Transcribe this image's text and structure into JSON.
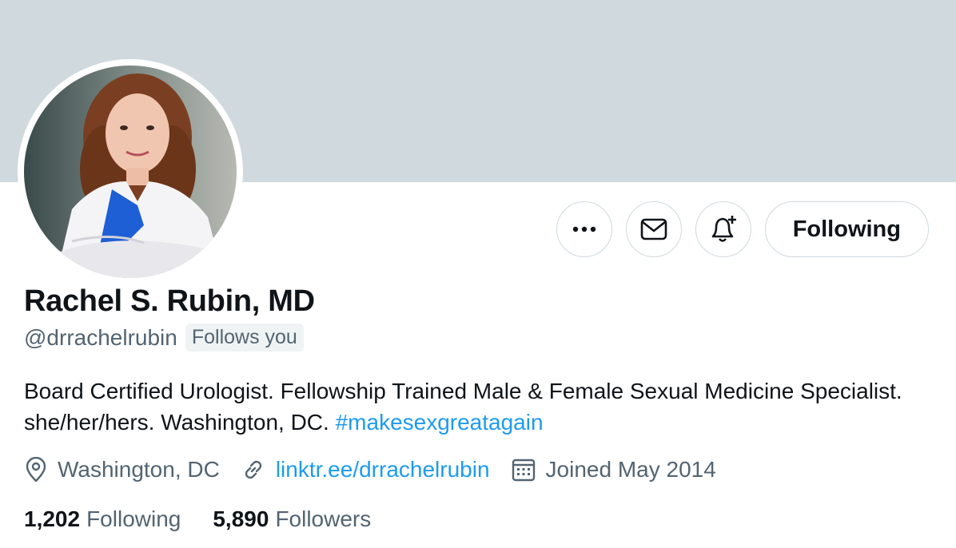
{
  "profile": {
    "display_name": "Rachel S. Rubin, MD",
    "handle": "@drrachelrubin",
    "follows_you": "Follows you",
    "bio_text": "Board Certified Urologist. Fellowship Trained Male & Female Sexual Medicine Specialist. she/her/hers. Washington, DC.",
    "bio_hashtag": "#makesexgreatagain",
    "location": "Washington, DC",
    "website": "linktr.ee/drrachelrubin",
    "joined": "Joined May 2014"
  },
  "stats": {
    "following_count": "1,202",
    "following_label": "Following",
    "followers_count": "5,890",
    "followers_label": "Followers"
  },
  "actions": {
    "more_icon": "more-icon",
    "message_icon": "envelope-icon",
    "notify_icon": "bell-plus-icon",
    "following_button_label": "Following"
  },
  "colors": {
    "banner": "#cfd9de",
    "link": "#1d9bf0",
    "secondary_text": "#536471",
    "primary_text": "#0f1419"
  }
}
